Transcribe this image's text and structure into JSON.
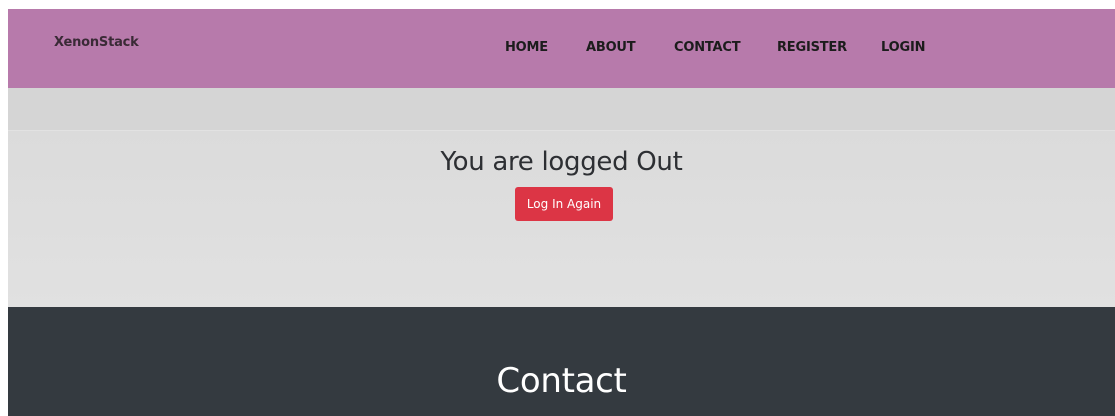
{
  "navbar": {
    "brand": "XenonStack",
    "links": [
      "HOME",
      "ABOUT",
      "CONTACT",
      "REGISTER",
      "LOGIN"
    ],
    "background_color": "#b77aab"
  },
  "hero": {
    "title": "You are logged Out",
    "button_label": "Log In Again",
    "button_color": "#dc3545"
  },
  "footer": {
    "title": "Contact",
    "background_color": "#343a40"
  }
}
